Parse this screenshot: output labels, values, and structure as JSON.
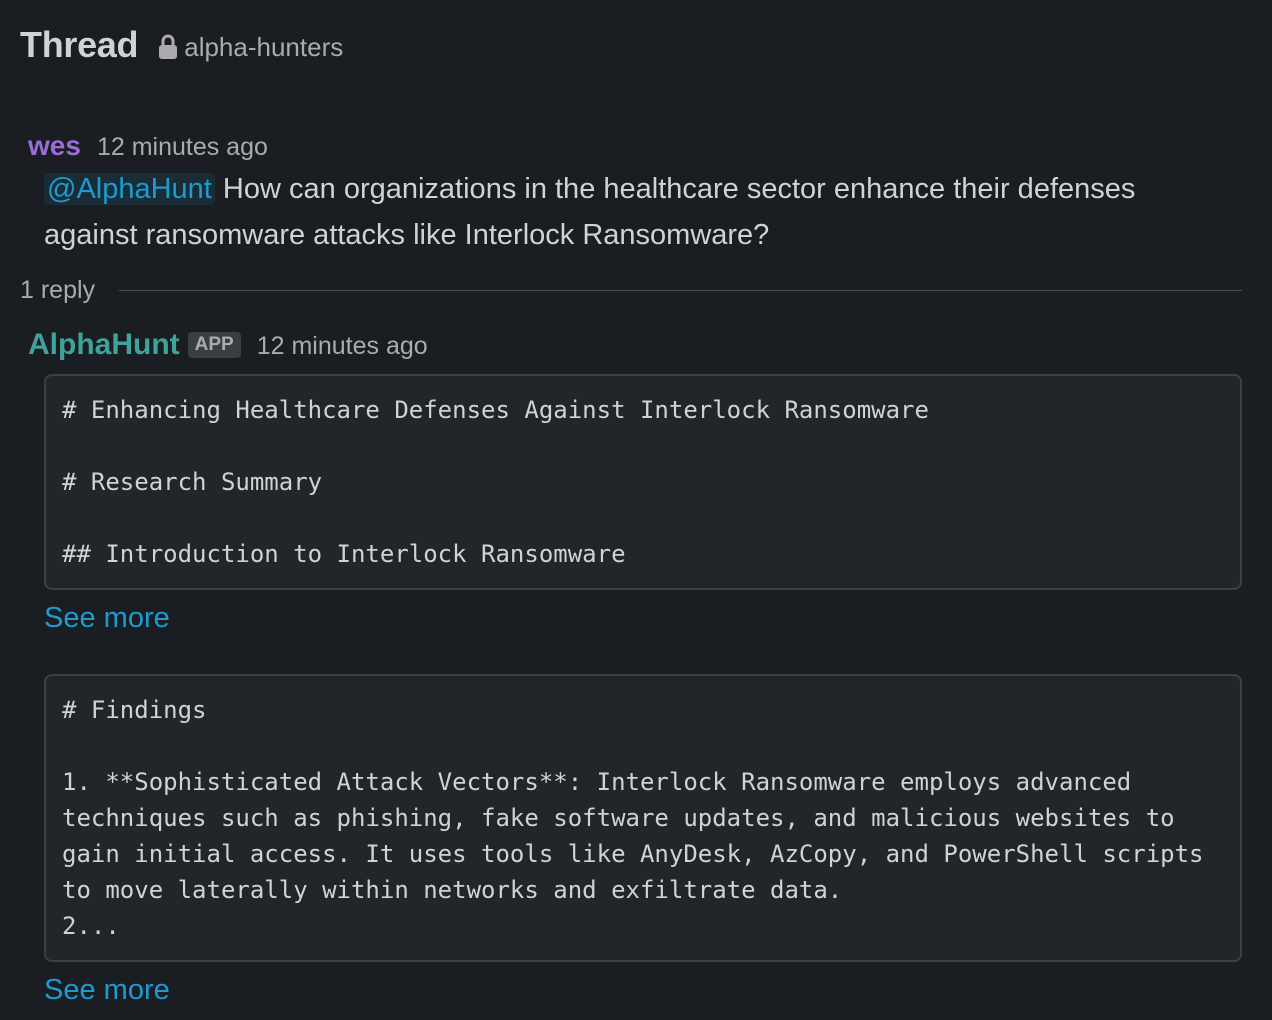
{
  "header": {
    "title": "Thread",
    "channel": "alpha-hunters"
  },
  "parent_message": {
    "author": "wes",
    "timestamp": "12 minutes ago",
    "mention": "@AlphaHunt",
    "text": " How can organizations in the healthcare sector enhance their defenses against ransomware attacks like Interlock Ransomware?"
  },
  "replies": {
    "count_label": "1 reply"
  },
  "reply_message": {
    "author": "AlphaHunt",
    "badge": "APP",
    "timestamp": "12 minutes ago",
    "blocks": [
      {
        "code": "# Enhancing Healthcare Defenses Against Interlock Ransomware\n\n# Research Summary\n\n## Introduction to Interlock Ransomware",
        "see_more": "See more"
      },
      {
        "code": "# Findings\n\n1. **Sophisticated Attack Vectors**: Interlock Ransomware employs advanced\ntechniques such as phishing, fake software updates, and malicious websites to\ngain initial access. It uses tools like AnyDesk, AzCopy, and PowerShell scripts\nto move laterally within networks and exfiltrate data.\n2...",
        "see_more": "See more"
      }
    ]
  },
  "colors": {
    "background": "#1a1d21",
    "wes_name": "#9b6dd8",
    "bot_name": "#3fa39c",
    "link": "#1d9bd1"
  },
  "icons": {
    "channel": "lock-icon"
  }
}
